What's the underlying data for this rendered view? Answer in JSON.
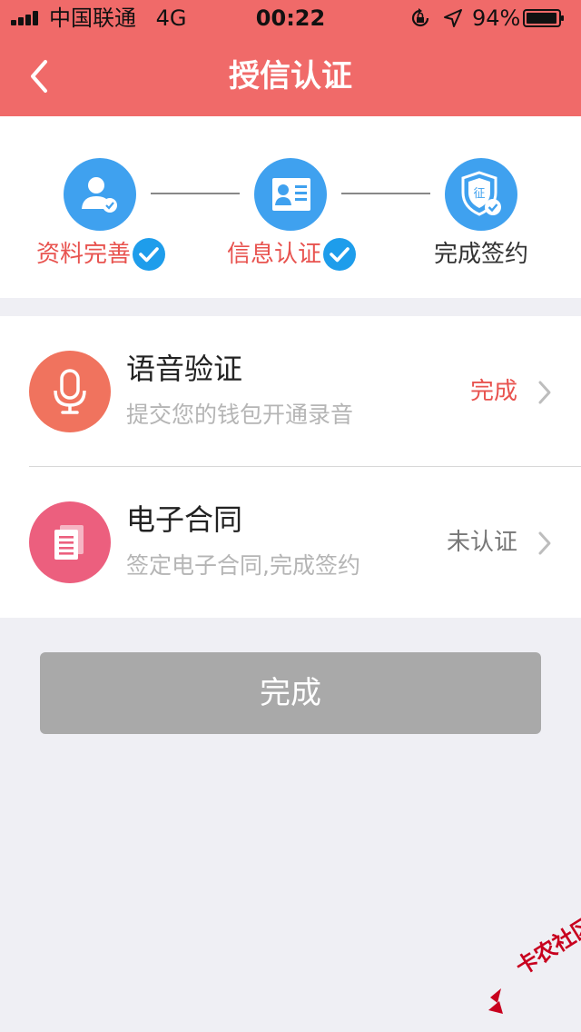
{
  "status_bar": {
    "carrier": "中国联通",
    "network": "4G",
    "time": "00:22",
    "battery_percent": "94%"
  },
  "nav": {
    "title": "授信认证",
    "back_icon": "chevron-left-icon"
  },
  "steps": [
    {
      "label": "资料完善",
      "state": "done",
      "icon": "user-check-icon"
    },
    {
      "label": "信息认证",
      "state": "done",
      "icon": "id-card-icon"
    },
    {
      "label": "完成签约",
      "state": "pending",
      "icon": "shield-seal-icon"
    }
  ],
  "rows": [
    {
      "title": "语音验证",
      "subtitle": "提交您的钱包开通录音",
      "status": "完成",
      "status_color": "#E8534F",
      "icon": "microphone-icon",
      "icon_color": "#F0735E"
    },
    {
      "title": "电子合同",
      "subtitle": "签定电子合同,完成签约",
      "status": "未认证",
      "status_color": "#777777",
      "icon": "document-icon",
      "icon_color": "#EC5F7E"
    }
  ],
  "done_button": {
    "label": "完成"
  },
  "watermark": {
    "text": "卡农社区"
  },
  "colors": {
    "header": "#F06A69",
    "step_blue": "#3FA1EF",
    "accent_red": "#E8534F",
    "check_blue": "#1E9DEB",
    "button_disabled": "#A9A9A9",
    "background": "#EFEFF4"
  }
}
